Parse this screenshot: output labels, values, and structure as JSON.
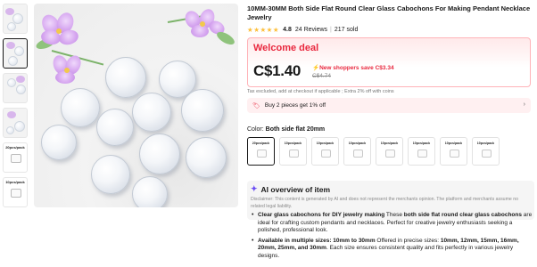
{
  "product": {
    "title": "10MM-30MM Both Side Flat Round Clear Glass Cabochons For Making Pendant Necklace Jewelry",
    "stars": "★★★★★",
    "rating": "4.8",
    "reviews": "24 Reviews",
    "sold": "217 sold"
  },
  "thumbnails": [
    {
      "type": "photo"
    },
    {
      "type": "photo",
      "active": true
    },
    {
      "type": "photo"
    },
    {
      "type": "photo"
    },
    {
      "type": "pack",
      "label": "20pcs/pack"
    },
    {
      "type": "pack",
      "label": "10pcs/pack"
    }
  ],
  "deal": {
    "title": "Welcome deal",
    "price": "C$1.40",
    "save_text": "New shoppers save C$3.34",
    "original_price": "C$4.74"
  },
  "tax_note": "Tax excluded, add at checkout if applicable ; Extra 2% off with coins",
  "promo": {
    "text": "Buy 2 pieces get 1% off",
    "chevron": "›"
  },
  "color": {
    "label": "Color:",
    "value": "Both side flat 20mm",
    "swatches": [
      "20pcs/pack",
      "10pcs/pack",
      "10pcs/pack",
      "10pcs/pack",
      "10pcs/pack",
      "10pcs/pack",
      "10pcs/pack",
      "10pcs/pack"
    ]
  },
  "ai": {
    "title": "AI overview of item",
    "disclaimer": "Disclaimer: This content is generated by AI and does not represent the merchants opinion. The platform and merchants assume no related legal liability."
  },
  "bullets": [
    {
      "bold1": "Clear glass cabochons for DIY jewelry making",
      "text1": " These ",
      "bold2": "both side flat round clear glass cabochons",
      "text2": " are ideal for crafting custom pendants and necklaces. Perfect for creative jewelry enthusiasts seeking a polished, professional look."
    },
    {
      "bold1": "Available in multiple sizes: 10mm to 30mm",
      "text1": " Offered in precise sizes: ",
      "bold2": "10mm, 12mm, 15mm, 16mm, 20mm, 25mm, and 30mm",
      "text2": ". Each size ensures consistent quality and fits perfectly in various jewelry designs."
    }
  ]
}
